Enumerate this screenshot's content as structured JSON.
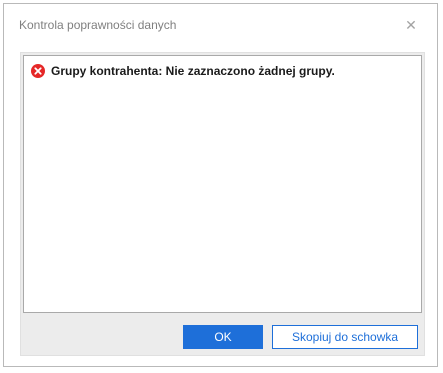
{
  "dialog": {
    "title": "Kontrola poprawności danych",
    "close_icon": "close-icon"
  },
  "message": {
    "icon": "error-icon",
    "icon_color": "#e52727",
    "text": "Grupy kontrahenta: Nie zaznaczono żadnej grupy."
  },
  "buttons": {
    "ok_label": "OK",
    "copy_label": "Skopiuj do schowka"
  },
  "colors": {
    "accent": "#1e6fd9"
  }
}
